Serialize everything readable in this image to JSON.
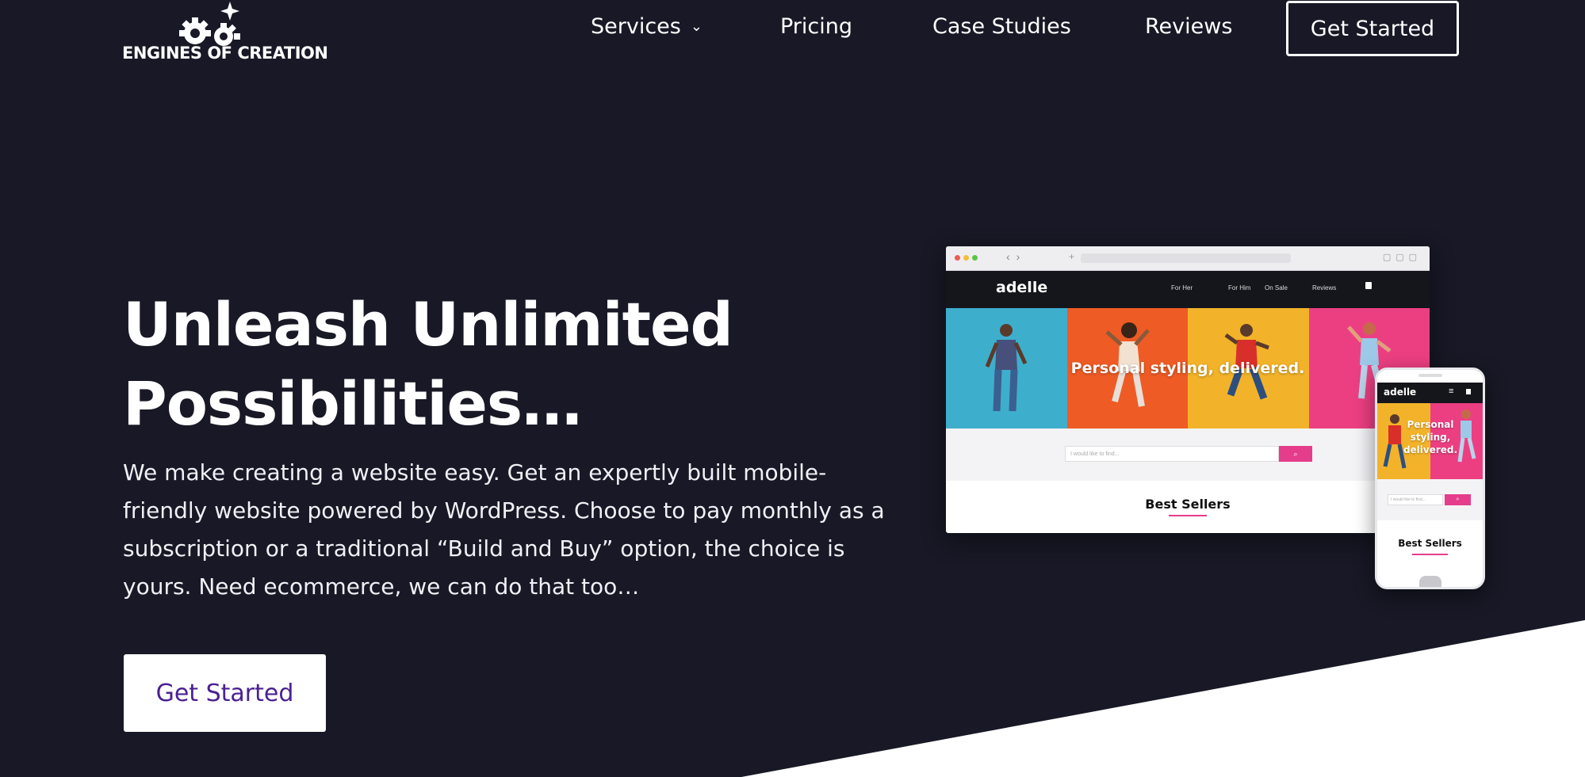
{
  "brand": {
    "name": "ENGINES OF CREATION"
  },
  "nav": {
    "items": [
      {
        "label": "Services"
      },
      {
        "label": "Pricing"
      },
      {
        "label": "Case Studies"
      },
      {
        "label": "Reviews"
      }
    ],
    "cta_label": "Get Started"
  },
  "hero": {
    "title_line1": "Unleash Unlimited",
    "title_line2": "Possibilities…",
    "description": "We make creating a website easy. Get an expertly built mobile-friendly website powered by WordPress. Choose to pay monthly as a subscription or a traditional “Build and Buy” option, the choice is yours. Need ecommerce, we can do that too…",
    "cta_label": "Get Started"
  },
  "mockup": {
    "logo": "adelle",
    "links": [
      "For Her",
      "For Him",
      "On Sale",
      "Reviews"
    ],
    "banner": "Personal styling, delivered.",
    "search_placeholder": "I would like to find...",
    "section_title": "Best Sellers",
    "panel_colors": [
      "#3eaecd",
      "#ef5b25",
      "#f2b32a",
      "#ec3f82"
    ]
  },
  "phone": {
    "logo": "adelle",
    "banner": "Personal styling, delivered.",
    "search_placeholder": "I would like to find...",
    "section_title": "Best Sellers"
  },
  "colors": {
    "background": "#181826",
    "accent": "#e53d8c",
    "cta_text": "#4b2192"
  }
}
